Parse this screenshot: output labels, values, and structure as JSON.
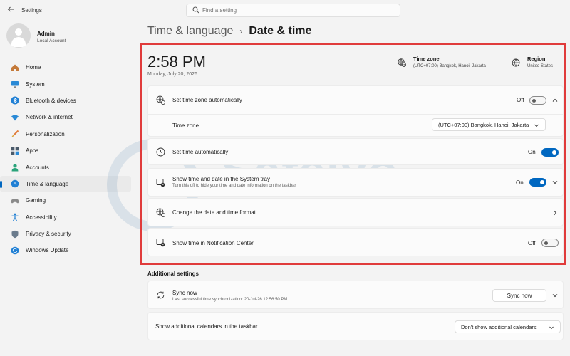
{
  "window": {
    "app_title": "Settings"
  },
  "search": {
    "placeholder": "Find a setting"
  },
  "user": {
    "name": "Admin",
    "account_type": "Local Account"
  },
  "sidebar": {
    "items": [
      {
        "label": "Home",
        "icon": "home-icon"
      },
      {
        "label": "System",
        "icon": "system-icon"
      },
      {
        "label": "Bluetooth & devices",
        "icon": "bluetooth-icon"
      },
      {
        "label": "Network & internet",
        "icon": "network-icon"
      },
      {
        "label": "Personalization",
        "icon": "brush-icon"
      },
      {
        "label": "Apps",
        "icon": "apps-icon"
      },
      {
        "label": "Accounts",
        "icon": "accounts-icon"
      },
      {
        "label": "Time & language",
        "icon": "time-language-icon",
        "active": true
      },
      {
        "label": "Gaming",
        "icon": "gaming-icon"
      },
      {
        "label": "Accessibility",
        "icon": "accessibility-icon"
      },
      {
        "label": "Privacy & security",
        "icon": "shield-icon"
      },
      {
        "label": "Windows Update",
        "icon": "update-icon"
      }
    ]
  },
  "breadcrumb": {
    "parent": "Time & language",
    "separator": "›",
    "current": "Date & time"
  },
  "clock": {
    "time": "2:58 PM",
    "date": "Monday, July 20, 2026"
  },
  "timezone_info": {
    "label": "Time zone",
    "value": "(UTC+07:00) Bangkok, Hanoi, Jakarta"
  },
  "region_info": {
    "label": "Region",
    "value": "United States"
  },
  "settings": {
    "tz_auto": {
      "title": "Set time zone automatically",
      "state": "Off"
    },
    "tz_select": {
      "title": "Time zone",
      "value": "(UTC+07:00) Bangkok, Hanoi, Jakarta"
    },
    "time_auto": {
      "title": "Set time automatically",
      "state": "On"
    },
    "systray": {
      "title": "Show time and date in the System tray",
      "subtitle": "Turn this off to hide your time and date information on the taskbar",
      "state": "On"
    },
    "format": {
      "title": "Change the date and time format"
    },
    "notif": {
      "title": "Show time in Notification Center",
      "state": "Off"
    }
  },
  "additional": {
    "heading": "Additional settings",
    "sync": {
      "title": "Sync now",
      "subtitle": "Last successful time synchronization: 20-Jul-26 12:56:50 PM",
      "button": "Sync now"
    },
    "calendars": {
      "title": "Show additional calendars in the taskbar",
      "value": "Don't show additional calendars"
    }
  },
  "watermark": {
    "text": "Safelyo"
  },
  "colors": {
    "accent": "#0067c0",
    "highlight_border": "#e03b3b",
    "background": "#f3f3f3"
  }
}
